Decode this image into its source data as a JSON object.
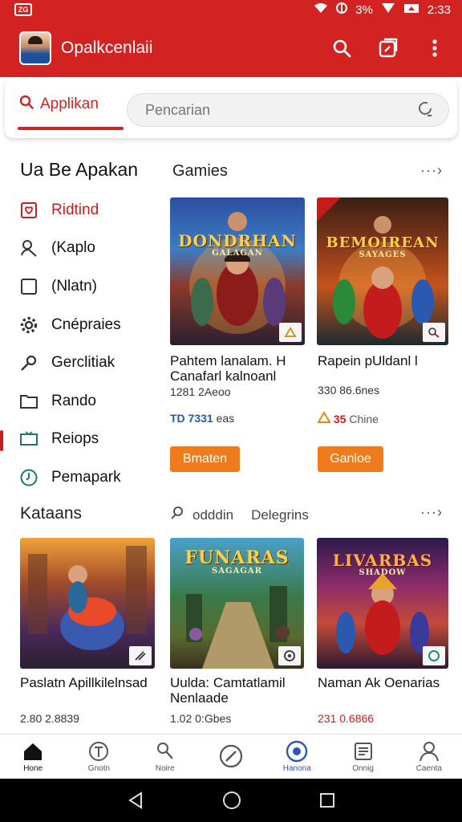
{
  "status_bar": {
    "left_icon": "ZG",
    "battery": "3%",
    "time": "2:33"
  },
  "app_bar": {
    "title": "Opalkcenlaii"
  },
  "search": {
    "tab_label": "Applikan",
    "placeholder": "Pencarian"
  },
  "sidebar": {
    "heading": "Ua Be Apakan",
    "items": [
      {
        "label": "Ridtind",
        "icon": "heart-box-icon"
      },
      {
        "label": "(Kaplo",
        "icon": "person-icon"
      },
      {
        "label": "(Nlatn)",
        "icon": "square-icon"
      },
      {
        "label": "Cnépraies",
        "icon": "gear-icon"
      },
      {
        "label": "Gerclitiak",
        "icon": "key-icon"
      },
      {
        "label": "Rando",
        "icon": "folder-icon"
      },
      {
        "label": "Reiops",
        "icon": "tv-icon"
      },
      {
        "label": "Pemapark",
        "icon": "clock-icon"
      }
    ]
  },
  "games": {
    "heading": "Gamies",
    "more": "···›",
    "cards": [
      {
        "art_title": "DONDRHAN",
        "art_sub": "GALAGAN",
        "title": "Pahtem lanalam. H Canafarl kalnoanl",
        "meta": "1281 2Aeoo",
        "price": "TD 7331",
        "price_suffix": "eas",
        "button": "Bmaten",
        "price_color": "#2b57b5"
      },
      {
        "art_title": "BEMOIREAN",
        "art_sub": "SAYAGES",
        "title": "Rapein pUldanl l",
        "meta": "330 86.6nes",
        "price": "35",
        "price_suffix": "Chine",
        "button": "Ganloe",
        "price_color": "#e08a12"
      }
    ]
  },
  "kataans": {
    "heading": "Kataans",
    "more": "···›",
    "filters": [
      "odddin",
      "Delegrins"
    ],
    "cards": [
      {
        "art_title": "",
        "title": "Paslatn Apillkilelnsad",
        "meta": "2.80 2.8839"
      },
      {
        "art_title": "FUNARAS",
        "art_sub": "SAGAGAR",
        "title": "Uulda: Camtatlamil Nenlaade",
        "meta": "1.02 0:Gbes"
      },
      {
        "art_title": "LIVARBAS",
        "art_sub": "SHADOW",
        "title": "Naman Ak Oenarias",
        "meta": "231 0.6866"
      }
    ]
  },
  "bottom_nav": [
    {
      "label": "Hone",
      "icon": "home-icon"
    },
    {
      "label": "Gnotn",
      "icon": "brush-icon"
    },
    {
      "label": "Noire",
      "icon": "search-person-icon"
    },
    {
      "label": "",
      "icon": "compass-icon"
    },
    {
      "label": "Hanona",
      "icon": "target-icon"
    },
    {
      "label": "Onnig",
      "icon": "document-icon"
    },
    {
      "label": "Caenta",
      "icon": "profile-icon"
    }
  ]
}
